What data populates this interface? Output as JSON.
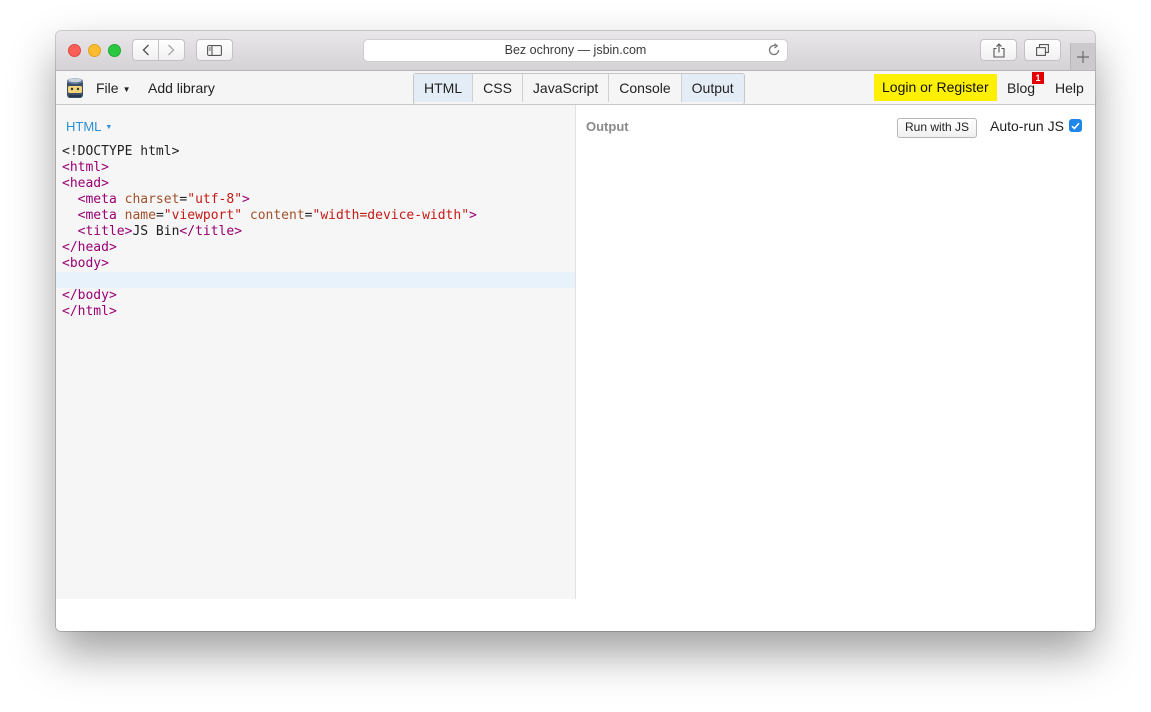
{
  "browser": {
    "address": "Bez ochrony — jsbin.com",
    "icons": [
      "back-icon",
      "forward-icon",
      "sidebar-icon",
      "reload-icon",
      "share-icon",
      "tabs-icon",
      "plus-icon"
    ]
  },
  "toolbar": {
    "file_label": "File",
    "add_library_label": "Add library",
    "panels": [
      "HTML",
      "CSS",
      "JavaScript",
      "Console",
      "Output"
    ],
    "active_panels": [
      "HTML",
      "Output"
    ],
    "login_label": "Login or Register",
    "blog_label": "Blog",
    "blog_badge": "1",
    "help_label": "Help",
    "login_color": "#fef002"
  },
  "editor": {
    "label": "HTML",
    "lines": [
      [
        {
          "t": "tx",
          "v": "<!DOCTYPE html>"
        }
      ],
      [
        {
          "t": "tg",
          "v": "<html>"
        }
      ],
      [
        {
          "t": "tg",
          "v": "<head>"
        }
      ],
      [
        {
          "t": "tx",
          "v": "  "
        },
        {
          "t": "tg",
          "v": "<meta "
        },
        {
          "t": "at",
          "v": "charset"
        },
        {
          "t": "tx",
          "v": "="
        },
        {
          "t": "st",
          "v": "\"utf-8\""
        },
        {
          "t": "tg",
          "v": ">"
        }
      ],
      [
        {
          "t": "tx",
          "v": "  "
        },
        {
          "t": "tg",
          "v": "<meta "
        },
        {
          "t": "at",
          "v": "name"
        },
        {
          "t": "tx",
          "v": "="
        },
        {
          "t": "st",
          "v": "\"viewport\""
        },
        {
          "t": "tx",
          "v": " "
        },
        {
          "t": "at",
          "v": "content"
        },
        {
          "t": "tx",
          "v": "="
        },
        {
          "t": "st",
          "v": "\"width=device-width\""
        },
        {
          "t": "tg",
          "v": ">"
        }
      ],
      [
        {
          "t": "tx",
          "v": "  "
        },
        {
          "t": "tg",
          "v": "<title>"
        },
        {
          "t": "tx",
          "v": "JS Bin"
        },
        {
          "t": "tg",
          "v": "</title>"
        }
      ],
      [
        {
          "t": "tg",
          "v": "</head>"
        }
      ],
      [
        {
          "t": "tg",
          "v": "<body>"
        }
      ],
      [],
      [
        {
          "t": "tg",
          "v": "</body>"
        }
      ],
      [
        {
          "t": "tg",
          "v": "</html>"
        }
      ]
    ],
    "highlight_line": 8
  },
  "output": {
    "label": "Output",
    "run_button": "Run with JS",
    "autorun_label": "Auto-run JS",
    "autorun_checked": true
  }
}
